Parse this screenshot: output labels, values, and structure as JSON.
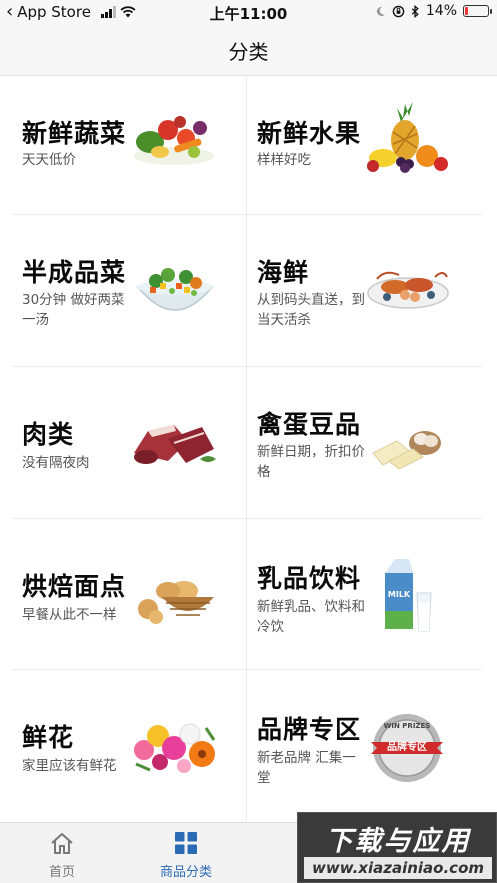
{
  "status_bar": {
    "back_app": "App Store",
    "time": "上午11:00",
    "battery": "14%",
    "battery_level": 0.14,
    "icons": [
      "back-chevron-icon",
      "signal-icon",
      "wifi-icon",
      "moon-icon",
      "orientation-lock-icon",
      "bluetooth-icon",
      "battery-icon"
    ]
  },
  "nav": {
    "title": "分类"
  },
  "categories": [
    {
      "name": "新鲜蔬菜",
      "desc": "天天低价",
      "icon": "vegetables-image"
    },
    {
      "name": "新鲜水果",
      "desc": "样样好吃",
      "icon": "fruits-image"
    },
    {
      "name": "半成品菜",
      "desc": "30分钟 做好两菜一汤",
      "icon": "salad-bowl-image"
    },
    {
      "name": "海鲜",
      "desc": "从到码头直送，到当天活杀",
      "icon": "seafood-platter-image"
    },
    {
      "name": "肉类",
      "desc": "没有隔夜肉",
      "icon": "meat-image"
    },
    {
      "name": "禽蛋豆品",
      "desc": "新鲜日期，折扣价格",
      "icon": "eggs-tofu-image"
    },
    {
      "name": "烘焙面点",
      "desc": "早餐从此不一样",
      "icon": "bread-basket-image"
    },
    {
      "name": "乳品饮料",
      "desc": "新鲜乳品、饮料和冷饮",
      "icon": "milk-carton-image"
    },
    {
      "name": "鲜花",
      "desc": "家里应该有鲜花",
      "icon": "flower-bouquet-image"
    },
    {
      "name": "品牌专区",
      "desc": "新老品牌 汇集一堂",
      "icon": "brand-badge-image",
      "badge_text": "品牌专区",
      "badge_ribbon": "WIN PRIZES"
    }
  ],
  "tabs": [
    {
      "label": "首页",
      "icon": "home-icon",
      "active": false
    },
    {
      "label": "商品分类",
      "icon": "category-grid-icon",
      "active": true
    }
  ],
  "watermark": {
    "title": "下载与应用",
    "url": "www.xiazainiao.com"
  },
  "colors": {
    "accent": "#2a6bb3",
    "background": "#ffffff",
    "bar": "#f7f7f7",
    "battery_low": "#e33333"
  }
}
